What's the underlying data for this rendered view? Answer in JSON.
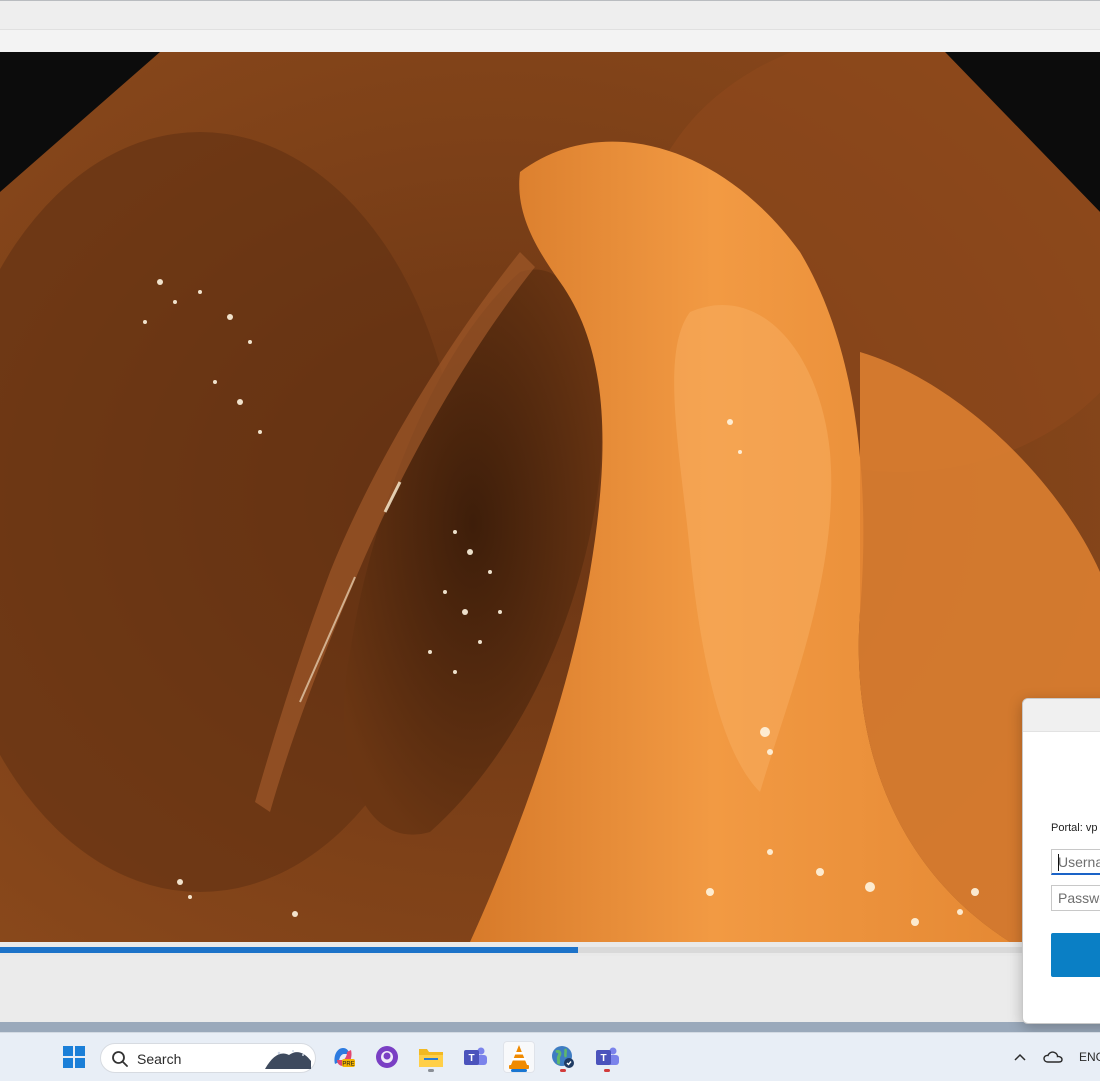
{
  "taskbar": {
    "search_label": "Search",
    "language": "ENG",
    "apps": [
      {
        "icon": "copilot-icon"
      },
      {
        "icon": "github-desktop-icon"
      },
      {
        "icon": "file-explorer-icon"
      },
      {
        "icon": "teams-icon"
      },
      {
        "icon": "vlc-icon"
      },
      {
        "icon": "vpn-globe-icon"
      },
      {
        "icon": "teams-icon"
      }
    ]
  },
  "player": {
    "progress": 0.525
  },
  "vpn_dialog": {
    "portal_label": "Portal: vp",
    "username_placeholder": "Userna",
    "password_placeholder": "Passwo"
  },
  "colors": {
    "accent": "#1d73c9",
    "connect_button": "#0a7fc5",
    "taskbar": "#e8eef6"
  }
}
